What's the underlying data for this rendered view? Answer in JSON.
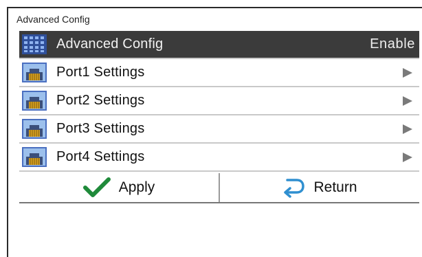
{
  "window": {
    "title": "Advanced Config"
  },
  "menu": {
    "items": [
      {
        "label": "Advanced Config",
        "value": "Enable",
        "icon": "grid-icon",
        "selected": true
      },
      {
        "label": "Port1 Settings",
        "icon": "network-port-icon",
        "arrow": "chevron-right-icon"
      },
      {
        "label": "Port2 Settings",
        "icon": "network-port-icon",
        "arrow": "chevron-right-icon"
      },
      {
        "label": "Port3 Settings",
        "icon": "network-port-icon",
        "arrow": "chevron-right-icon"
      },
      {
        "label": "Port4 Settings",
        "icon": "network-port-icon",
        "arrow": "chevron-right-icon"
      }
    ]
  },
  "actions": {
    "apply": {
      "label": "Apply",
      "icon": "checkmark-icon"
    },
    "return": {
      "label": "Return",
      "icon": "return-arrow-icon"
    }
  },
  "colors": {
    "selected_row_bg": "#3b3b3b",
    "check_green": "#1f8a3a",
    "return_blue": "#2f8fd0",
    "port_icon_blue": "#3b63b5",
    "port_icon_gold": "#d9a21f"
  }
}
